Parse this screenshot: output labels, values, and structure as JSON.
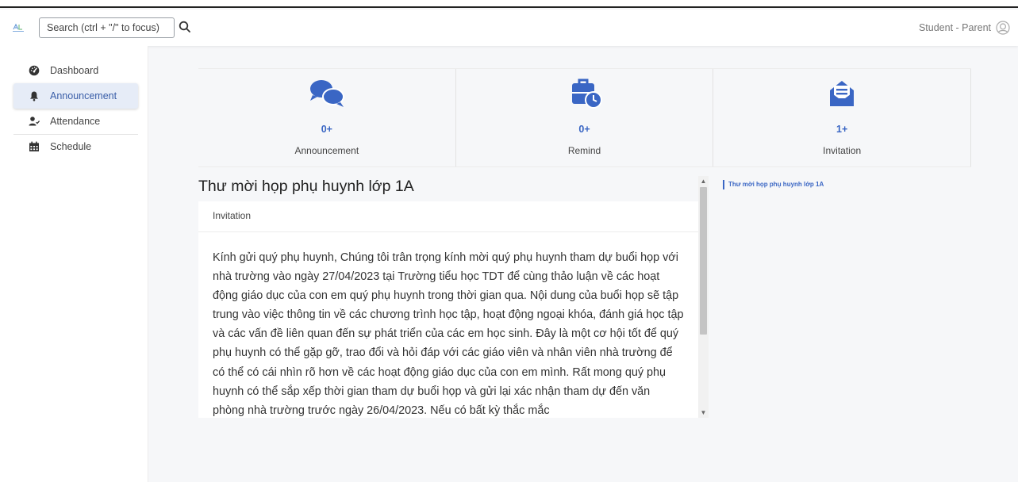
{
  "header": {
    "search_placeholder": "Search (ctrl + \"/\" to focus)",
    "user_label": "Student - Parent"
  },
  "sidebar": {
    "items": [
      {
        "label": "Dashboard",
        "icon": "dashboard-icon"
      },
      {
        "label": "Announcement",
        "icon": "bell-icon",
        "active": true
      },
      {
        "label": "Attendance",
        "icon": "user-check-icon"
      },
      {
        "label": "Schedule",
        "icon": "calendar-icon"
      }
    ]
  },
  "stats": [
    {
      "count": "0+",
      "label": "Announcement",
      "icon": "comments-icon"
    },
    {
      "count": "0+",
      "label": "Remind",
      "icon": "briefcase-clock-icon"
    },
    {
      "count": "1+",
      "label": "Invitation",
      "icon": "envelope-open-icon"
    }
  ],
  "detail": {
    "title": "Thư mời họp phụ huynh lớp 1A",
    "category": "Invitation",
    "body": "Kính gửi quý phụ huynh, Chúng tôi trân trọng kính mời quý phụ huynh tham dự buổi họp với nhà trường vào ngày 27/04/2023 tại Trường tiểu học TDT để cùng thảo luận về các hoạt động giáo dục của con em quý phụ huynh trong thời gian qua. Nội dung của buổi họp sẽ tập trung vào việc thông tin về các chương trình học tập, hoạt động ngoại khóa, đánh giá học tập và các vấn đề liên quan đến sự phát triển của các em học sinh. Đây là một cơ hội tốt để quý phụ huynh có thể gặp gỡ, trao đổi và hỏi đáp với các giáo viên và nhân viên nhà trường để có thể có cái nhìn rõ hơn về các hoạt động giáo dục của con em mình. Rất mong quý phụ huynh có thể sắp xếp thời gian tham dự buổi họp và gửi lại xác nhận tham dự đến văn phòng nhà trường trước ngày 26/04/2023. Nếu có bất kỳ thắc mắc"
  },
  "toc": {
    "item": "Thư mời họp phụ huynh lớp 1A"
  },
  "colors": {
    "accent": "#3a66c4",
    "active_bg": "#e6ecf7"
  }
}
